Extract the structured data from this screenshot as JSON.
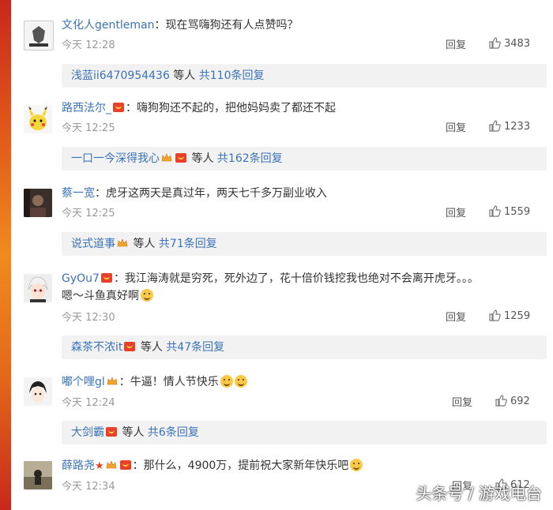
{
  "comments": [
    {
      "name": "文化人gentleman",
      "text": "：现在骂嗨狗还有人点赞吗？",
      "time": "今天 12:28",
      "reply": "回复",
      "likes": "3483",
      "sub": {
        "user": "浅蓝ii6470954436",
        "mid": " 等人 ",
        "count": "共110条回复"
      }
    },
    {
      "name": "路西法尔_",
      "text": "：嗨狗狗还不起的，把他妈妈卖了都还不起",
      "time": "今天 12:25",
      "reply": "回复",
      "likes": "1233",
      "sub": {
        "user": "一口一今深得我心",
        "mid": " 等人 ",
        "count": "共162条回复"
      }
    },
    {
      "name": "蔡一宽",
      "text": "：虎牙这两天是真过年，两天七千多万副业收入",
      "time": "今天 12:25",
      "reply": "回复",
      "likes": "1559",
      "sub": {
        "user": "说式道事",
        "mid": " 等人 ",
        "count": "共71条回复"
      }
    },
    {
      "name": "GyOu7",
      "text": "：我江海涛就是穷死，死外边了，花十倍价钱挖我也绝对不会离开虎牙。。。",
      "text2": "嗯～斗鱼真好啊",
      "time": "今天 12:30",
      "reply": "回复",
      "likes": "1259",
      "sub": {
        "user": "森茶不浓it",
        "mid": " 等人 ",
        "count": "共47条回复"
      }
    },
    {
      "name": "嘟个哩gl",
      "text": "：牛逼！情人节快乐",
      "time": "今天 12:24",
      "reply": "回复",
      "likes": "692",
      "sub": {
        "user": "大剑霸",
        "mid": " 等人 ",
        "count": "共6条回复"
      }
    },
    {
      "name": "薛路尧",
      "text": "：那什么，4900万，提前祝大家新年快乐吧",
      "time": "今天 12:34",
      "reply": "回复",
      "likes": "612"
    }
  ],
  "watermark": "头条号 / 游戏电台",
  "icons": {
    "like": "thumbs-up-icon",
    "badge": "fan-badge-icon",
    "crown": "crown-icon",
    "emoji": "emoji-icon",
    "star": "star-icon"
  },
  "colors": {
    "link": "#3b73b9",
    "sub_bg": "#f2f2f2",
    "badge": "#e8402a",
    "time": "#999999"
  }
}
